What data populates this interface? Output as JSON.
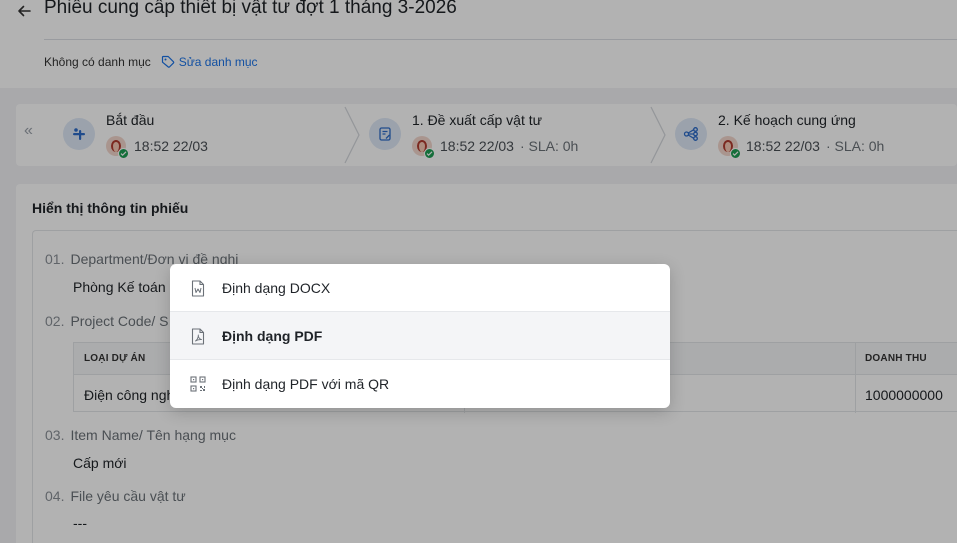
{
  "header": {
    "title": "Phiếu cung cấp thiết bị vật tư đợt 1 tháng 3-2026",
    "no_category": "Không có danh mục",
    "edit_category": "Sửa danh mục"
  },
  "stepper": {
    "steps": [
      {
        "title": "Bắt đầu",
        "time": "18:52 22/03",
        "sla": ""
      },
      {
        "title": "1. Đề xuất cấp vật tư",
        "time": "18:52 22/03",
        "sla": "· SLA: 0h"
      },
      {
        "title": "2. Kế hoạch cung ứng",
        "time": "18:52 22/03",
        "sla": "· SLA: 0h"
      }
    ]
  },
  "info": {
    "title": "Hiển thị thông tin phiếu",
    "fields": [
      {
        "num": "01.",
        "label": "Department/Đơn vị đề nghị",
        "value": "Phòng Kế toán -"
      },
      {
        "num": "02.",
        "label": "Project Code/ S",
        "value": ""
      },
      {
        "num": "03.",
        "label": "Item Name/ Tên hạng mục",
        "value": "Cấp mới"
      },
      {
        "num": "04.",
        "label": "File yêu cầu vật tư",
        "value": "---"
      }
    ],
    "table": {
      "headers": [
        "LOẠI DỰ ÁN",
        "DOANH THU"
      ],
      "row": [
        "Điện công ngh",
        "1000000000"
      ]
    }
  },
  "menu": {
    "items": [
      {
        "label": "Định dạng DOCX",
        "icon": "docx-file-icon"
      },
      {
        "label": "Định dạng PDF",
        "icon": "pdf-file-icon"
      },
      {
        "label": "Định dạng PDF với mã QR",
        "icon": "qr-code-icon"
      }
    ],
    "active_index": 1
  },
  "colors": {
    "accent": "#1a73e8",
    "success": "#1e9e53",
    "step_icon_bg": "#dfe9f7"
  }
}
